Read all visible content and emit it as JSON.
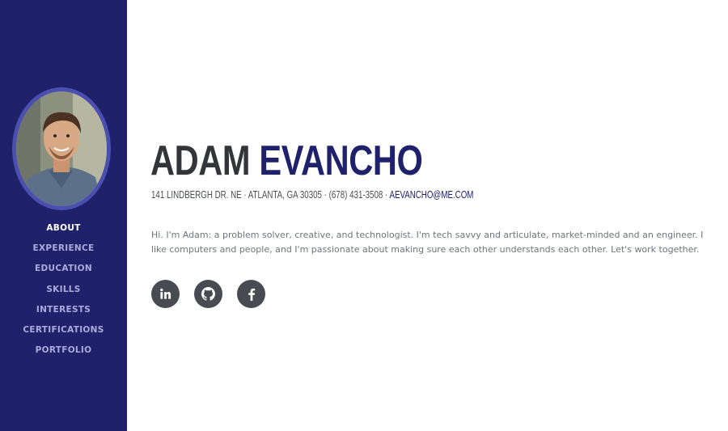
{
  "nav": {
    "items": [
      {
        "label": "ABOUT",
        "active": true
      },
      {
        "label": "EXPERIENCE"
      },
      {
        "label": "EDUCATION"
      },
      {
        "label": "SKILLS"
      },
      {
        "label": "INTERESTS"
      },
      {
        "label": "CERTIFICATIONS"
      },
      {
        "label": "PORTFOLIO"
      }
    ]
  },
  "profile": {
    "first_name": "ADAM",
    "last_name": "EVANCHO",
    "address": "141 LINDBERGH DR. NE · ATLANTA, GA 30305 · (678) 431-3508 · ",
    "email": "AEVANCHO@ME.COM",
    "bio": "Hi. I'm Adam: a problem solver, creative, and technologist. I'm tech savvy and articulate, market-minded and an engineer. I like computers and people, and I'm passionate about making sure each other understands each other. Let's work together."
  },
  "social": [
    {
      "icon": "linkedin-icon"
    },
    {
      "icon": "github-icon"
    },
    {
      "icon": "facebook-icon"
    }
  ],
  "colors": {
    "sidebar": "#1f216b",
    "accent": "#1f216b",
    "heading": "#333539",
    "social_bg": "#484c52"
  }
}
